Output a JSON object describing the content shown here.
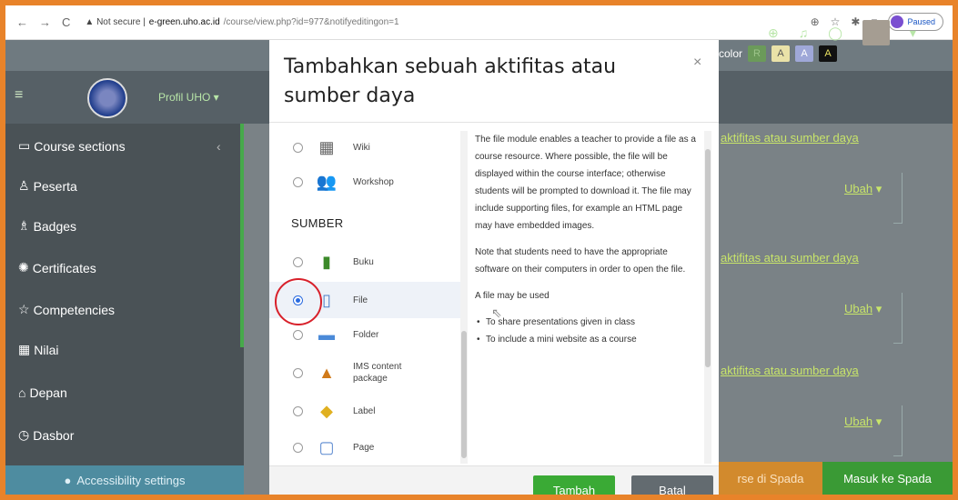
{
  "browser": {
    "nav_back": "←",
    "nav_forward": "→",
    "nav_reload": "C",
    "security": "▲ Not secure |",
    "host": "e-green.uho.ac.id",
    "path": "/course/view.php?id=977&notifyeditingon=1",
    "profile_status": "Paused"
  },
  "top": {
    "color_label": "color",
    "color_buttons": [
      {
        "label": "R",
        "bg": "#6b9a5a",
        "fg": "#9cc48a"
      },
      {
        "label": "A",
        "bg": "#eae2a8",
        "fg": "#555"
      },
      {
        "label": "A",
        "bg": "#9fa8d8",
        "fg": "#fff"
      },
      {
        "label": "A",
        "bg": "#111111",
        "fg": "#e8e060"
      }
    ]
  },
  "navbar": {
    "menu_icon": "≡",
    "profil": "Profil UHO ▾"
  },
  "sidebar": {
    "items": [
      {
        "label": "Course sections",
        "icon": "▭"
      },
      {
        "label": "Peserta",
        "icon": "♙"
      },
      {
        "label": "Badges",
        "icon": "♗"
      },
      {
        "label": "Certificates",
        "icon": "✺"
      },
      {
        "label": "Competencies",
        "icon": "☆"
      },
      {
        "label": "Nilai",
        "icon": "▦"
      },
      {
        "label": "Depan",
        "icon": "⌂"
      },
      {
        "label": "Dasbor",
        "icon": "◷"
      }
    ],
    "collapse_chevron": "‹",
    "accessibility": "Accessibility settings"
  },
  "main": {
    "add_link": "aktifitas atau sumber daya",
    "ubah": "Ubah",
    "ubah_caret": "▾",
    "kursus_spada": "rse di Spada",
    "masuk_spada": "Masuk ke Spada"
  },
  "modal": {
    "title": "Tambahkan sebuah aktifitas atau sumber daya",
    "close": "×",
    "activities": [
      {
        "label": "Wiki",
        "icon": "▦",
        "color": "#666"
      },
      {
        "label": "Workshop",
        "icon": "👥",
        "color": "#c98a20"
      }
    ],
    "resources_heading": "SUMBER",
    "resources": [
      {
        "label": "Buku",
        "icon": "▮",
        "color": "#3c8a2a",
        "selected": false
      },
      {
        "label": "File",
        "icon": "▯",
        "color": "#4b7fc8",
        "selected": true
      },
      {
        "label": "Folder",
        "icon": "▬",
        "color": "#4b8ad8",
        "selected": false
      },
      {
        "label": "IMS content package",
        "icon": "▲",
        "color": "#d07a1a",
        "selected": false
      },
      {
        "label": "Label",
        "icon": "◆",
        "color": "#e0b020",
        "selected": false
      },
      {
        "label": "Page",
        "icon": "▢",
        "color": "#5b8ad0",
        "selected": false
      }
    ],
    "description": {
      "p1": "The file module enables a teacher to provide a file as a course resource. Where possible, the file will be displayed within the course interface; otherwise students will be prompted to download it. The file may include supporting files, for example an HTML page may have embedded images.",
      "p2": "Note that students need to have the appropriate software on their computers in order to open the file.",
      "p3": "A file may be used",
      "bullets": [
        "To share presentations given in class",
        "To include a mini website as a course"
      ]
    },
    "add_button": "Tambah",
    "cancel_button": "Batal"
  },
  "colors": {
    "frame": "#e8832a",
    "accent_green": "#3aaa35",
    "link_green": "#c8e56a",
    "annotation_red": "#d8202a"
  }
}
